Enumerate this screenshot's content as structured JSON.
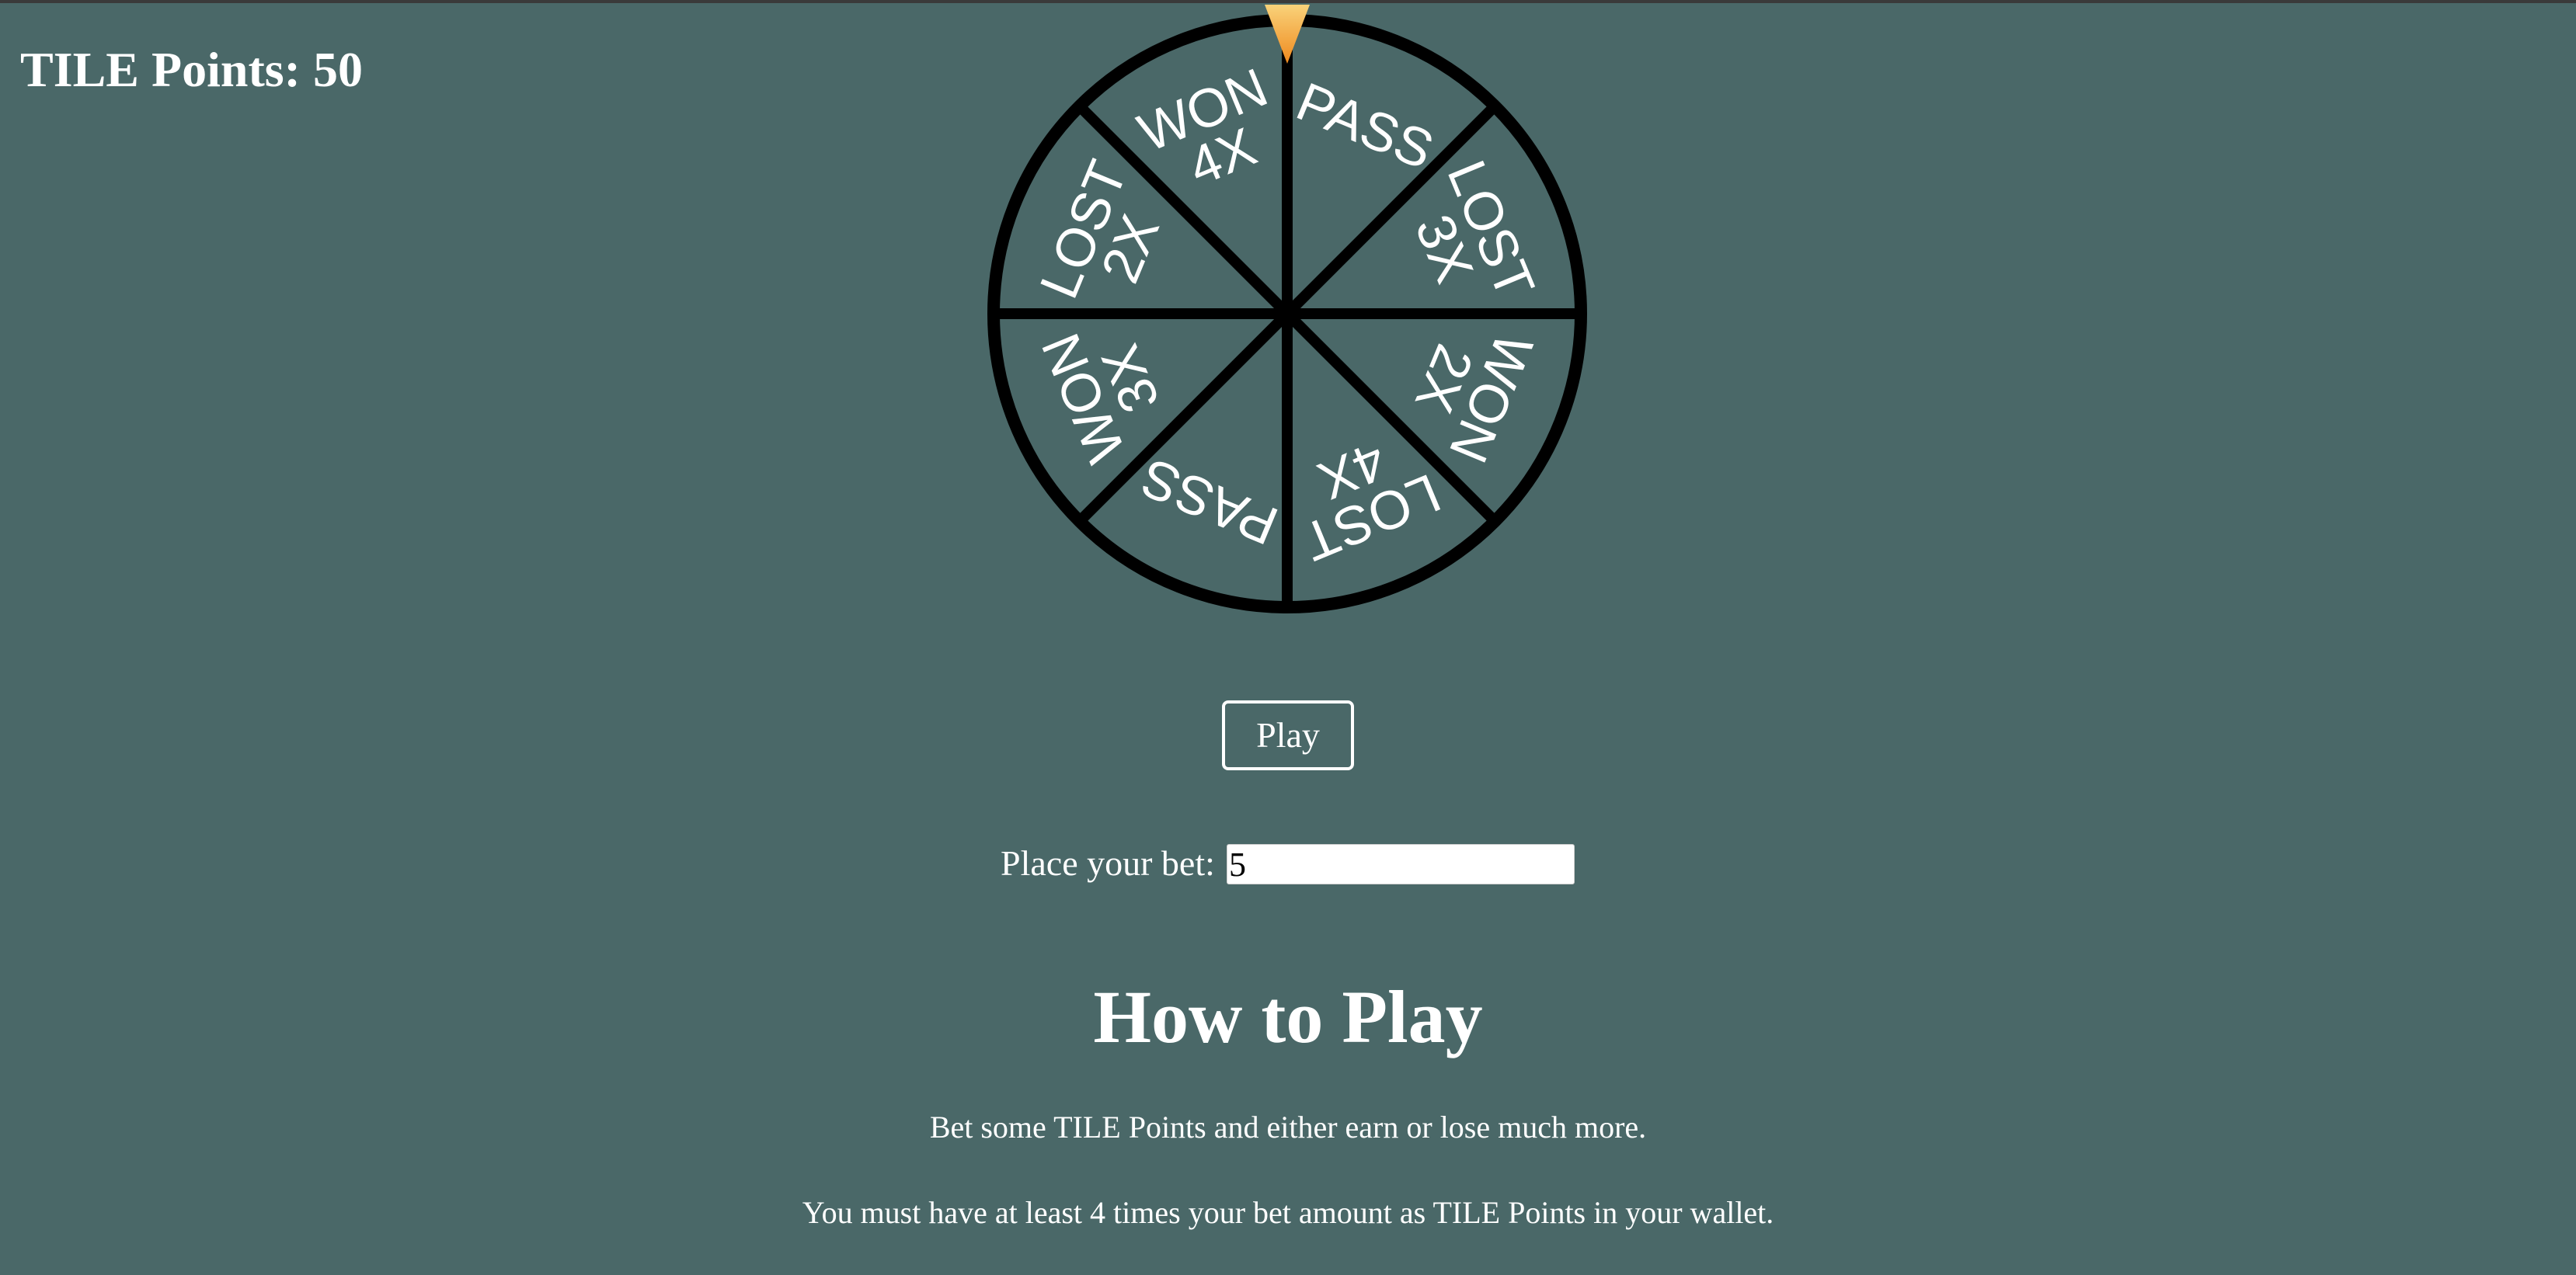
{
  "header": {
    "points_label": "TILE Points:",
    "points_value": "50"
  },
  "wheel": {
    "segments": [
      {
        "line1": "PASS",
        "line2": ""
      },
      {
        "line1": "LOST",
        "line2": "3X"
      },
      {
        "line1": "WON",
        "line2": "2X"
      },
      {
        "line1": "LOST",
        "line2": "4X"
      },
      {
        "line1": "PASS",
        "line2": ""
      },
      {
        "line1": "WON",
        "line2": "3X"
      },
      {
        "line1": "LOST",
        "line2": "2X"
      },
      {
        "line1": "WON",
        "line2": "4X"
      }
    ],
    "colors": {
      "fill": "#4a6868",
      "stroke": "#000000",
      "pointer_top": "#f9d27a",
      "pointer_bottom": "#ef8a1e"
    }
  },
  "controls": {
    "play_label": "Play",
    "bet_label": "Place your bet:",
    "bet_value": "5"
  },
  "howto": {
    "title": "How to Play",
    "line1": "Bet some TILE Points and either earn or lose much more.",
    "line2": "You must have at least 4 times your bet amount as TILE Points in your wallet."
  }
}
